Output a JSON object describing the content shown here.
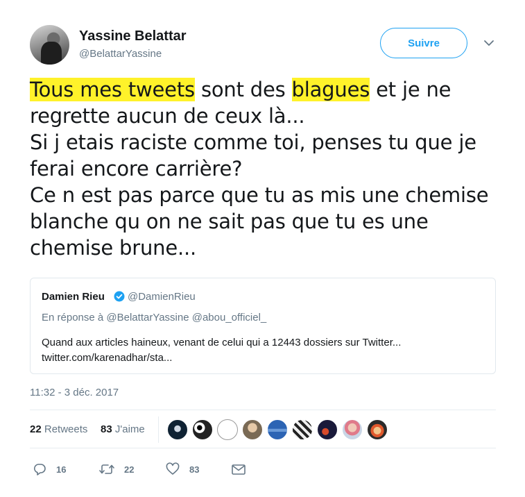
{
  "user": {
    "name": "Yassine Belattar",
    "handle": "@BelattarYassine",
    "follow_label": "Suivre"
  },
  "tweet": {
    "lines": [
      {
        "pre": "",
        "hl1": "Tous mes tweets",
        "mid": " sont des ",
        "hl2": "blagues",
        "post": " et je ne"
      },
      {
        "text": "regrette aucun de ceux là..."
      },
      {
        "text": "Si j etais raciste comme toi, penses tu que je"
      },
      {
        "text": "ferai encore carrière?"
      },
      {
        "text": "Ce n est pas parce que tu as mis une chemise"
      },
      {
        "text": "blanche qu on ne sait pas que tu es une"
      },
      {
        "text": "chemise brune..."
      }
    ]
  },
  "quote": {
    "name": "Damien Rieu",
    "handle": "@DamienRieu",
    "reply_to": "En réponse à @BelattarYassine @abou_officiel_",
    "body_line1": "Quand aux articles haineux, venant de celui qui a 12443 dossiers sur Twitter...",
    "body_line2": "twitter.com/karenadhar/sta..."
  },
  "timestamp": "11:32 - 3 déc. 2017",
  "stats": {
    "retweets_count": "22",
    "retweets_label": "Retweets",
    "likes_count": "83",
    "likes_label": "J'aime"
  },
  "actions": {
    "reply_count": "16",
    "retweet_count": "22",
    "like_count": "83"
  },
  "colors": {
    "accent": "#1da1f2",
    "highlight": "#fff22a",
    "secondary_text": "#657786"
  }
}
